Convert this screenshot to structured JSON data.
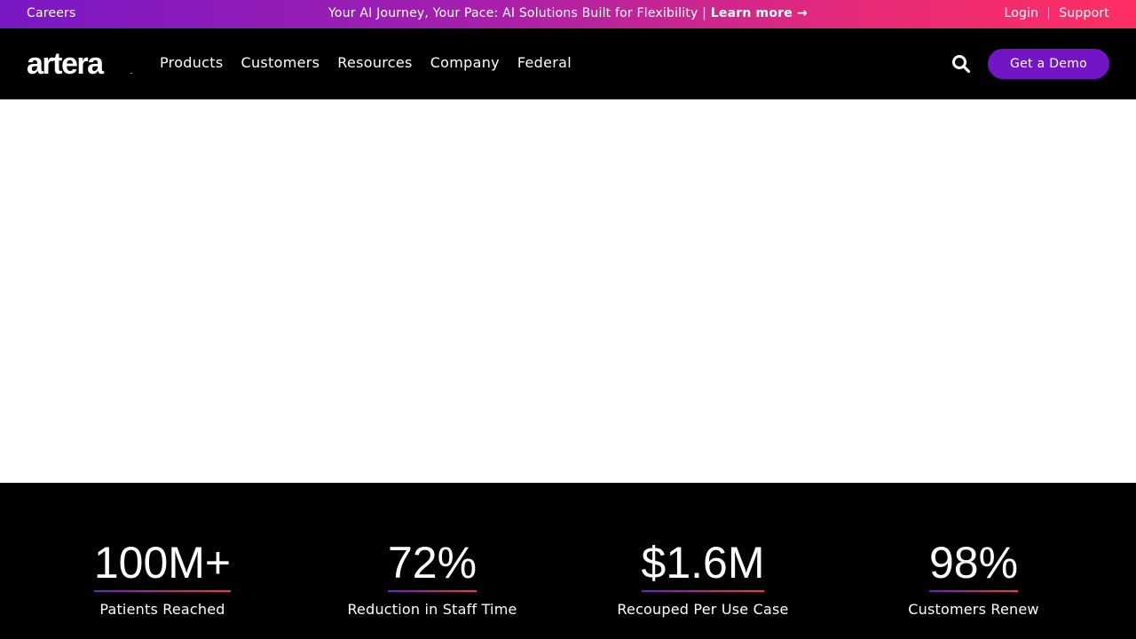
{
  "topbar": {
    "careers": "Careers",
    "announcement": "Your AI Journey, Your Pace: AI Solutions Built for Flexibility | ",
    "learn_more": "Learn more →",
    "login": "Login",
    "support": "Support"
  },
  "nav": {
    "logo": "artera",
    "items": [
      "Products",
      "Customers",
      "Resources",
      "Company",
      "Federal"
    ],
    "cta": "Get a Demo",
    "search_icon": "search-icon"
  },
  "stats": [
    {
      "value": "100M+",
      "label": "Patients Reached"
    },
    {
      "value": "72%",
      "label": "Reduction in Staff Time"
    },
    {
      "value": "$1.6M",
      "label": "Recouped Per Use Case"
    },
    {
      "value": "98%",
      "label": "Customers Renew"
    }
  ],
  "colors": {
    "topbar_start": "#7a18c4",
    "topbar_end": "#ff2e63",
    "nav_bg": "#000000",
    "cta_bg": "#7314c6",
    "stats_bg": "#000000"
  }
}
